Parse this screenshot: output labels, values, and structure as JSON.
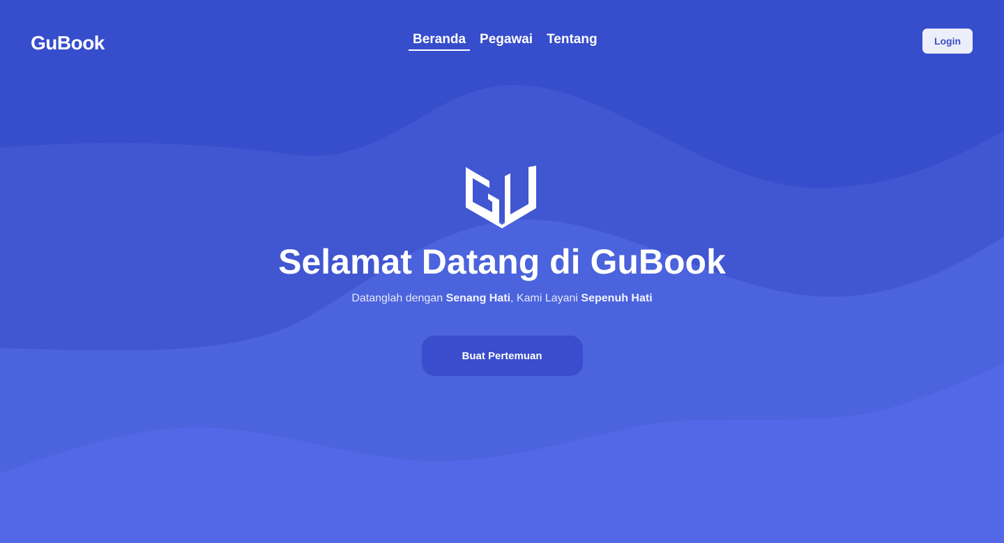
{
  "brand": "GuBook",
  "nav": {
    "items": [
      {
        "label": "Beranda",
        "active": true
      },
      {
        "label": "Pegawai",
        "active": false
      },
      {
        "label": "Tentang",
        "active": false
      }
    ],
    "login_label": "Login"
  },
  "hero": {
    "logo_icon": "open-book-gu-logo",
    "title": "Selamat Datang di GuBook",
    "subtitle": {
      "part1": "Datanglah dengan ",
      "bold1": "Senang Hati",
      "part2": ", Kami Layani ",
      "bold2": "Sepenuh Hati"
    },
    "cta_label": "Buat Pertemuan"
  },
  "colors": {
    "background_top": "#364dcc",
    "wave_middle": "#4156d1",
    "wave_lower": "#4b63dc",
    "wave_bottom": "#5268e6",
    "login_button_bg": "#eceef9",
    "cta_button_bg": "#3a4dcc"
  }
}
